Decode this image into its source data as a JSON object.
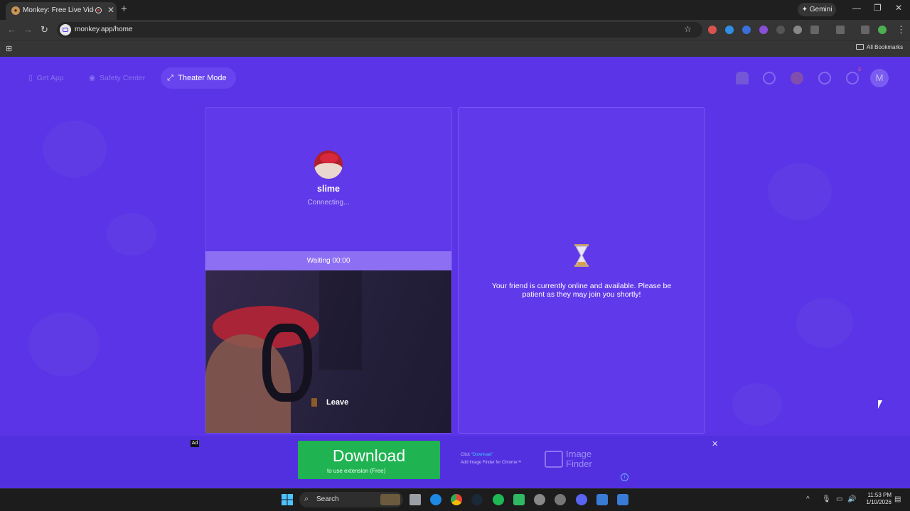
{
  "browser": {
    "tab_title": "Monkey: Free Live Video Ch",
    "tab_close": "✕",
    "new_tab": "+",
    "gemini_label": "✦ Gemini",
    "url": "monkey.app/home",
    "all_bookmarks": "All Bookmarks",
    "minimize": "—",
    "restore": "❐",
    "close": "✕"
  },
  "topnav": {
    "get_app": "Get App",
    "safety_center": "Safety Center",
    "theater_mode": "Theater Mode",
    "profile_initial": "M",
    "notification_count": "3"
  },
  "call": {
    "username": "slime",
    "status": "Connecting...",
    "waiting": "Waiting 00:00",
    "leave": "Leave"
  },
  "friend_panel": {
    "message": "Your friend is currently online and available. Please be patient as they may join you shortly!"
  },
  "ad": {
    "label": "Ad",
    "download": "Download",
    "download_sub": "to use extension (Free)",
    "step1_prefix": "Click ",
    "step1_highlight": "\"Download\"",
    "step2": "Add Image Finder for Chrome™",
    "brand_line1": "Image",
    "brand_line2": "Finder",
    "close": "✕",
    "info": "i"
  },
  "taskbar": {
    "search": "Search",
    "time": "11:53 PM",
    "date": "1/10/2026"
  },
  "colors": {
    "page_bg": "#5a34e6",
    "card_bg": "#6039ea",
    "waiting_bar": "#8c6ff3",
    "download_green": "#1fb351"
  },
  "icons": [
    "monkey-favicon",
    "record-icon",
    "star-icon",
    "apps-grid-icon",
    "folder-icon",
    "phone-icon",
    "shield-icon",
    "theater-icon",
    "hat-icon",
    "search-icon",
    "avatar-icon",
    "clock-icon",
    "chat-icon",
    "hourglass-icon",
    "door-icon",
    "windows-start-icon"
  ]
}
